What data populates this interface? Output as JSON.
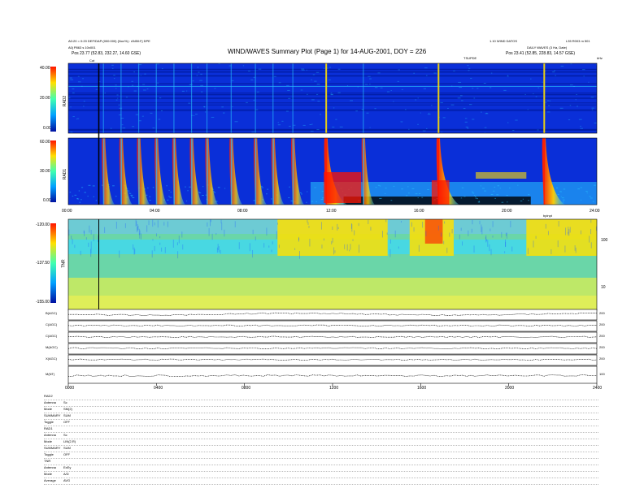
{
  "header": {
    "title": "WIND/WAVES Summary Plot (Page 1) for 14-AUG-2001, DOY = 226",
    "left_line1": "A0:20 = 0:20 DEF/DAP:(000:000) (Nov%) : AN50:Fj DPE",
    "left_line2": "A0j P863 s 10x001",
    "left_line3": "Pos   23.77 (52.83, 232.27, 14.60 GSE)",
    "right_line1": "1.10 WIND DATOS",
    "right_line2": "DAILY WAVES (3 Ha, Date)",
    "right_line3": "Pos   23.41 (52.85, 228.83, 14.57 GSE)",
    "right_corner": "L35 R003 m 501",
    "marker_label": "Cut",
    "rad1_mark": "TSUPDE",
    "tnr_mark": "bpinpt",
    "khz_mark": "kHz"
  },
  "panels": {
    "rad2": {
      "label": "RAD2",
      "ticks": [
        "40.00",
        "20.00",
        "0.00"
      ]
    },
    "rad1": {
      "label": "RAD1",
      "ticks": [
        "60.00",
        "30.00",
        "0.00"
      ]
    },
    "tnr": {
      "label": "TNR",
      "ticks": [
        "-120.00",
        "-137.50",
        "-155.00"
      ],
      "right_ticks": [
        "100",
        "10"
      ]
    }
  },
  "time_axis": {
    "ticks": [
      "00:00",
      "04:00",
      "08:00",
      "12:00",
      "16:00",
      "20:00",
      "24:00"
    ]
  },
  "bottom_axis": {
    "ticks": [
      "0000",
      "0400",
      "0800",
      "1200",
      "1600",
      "2000",
      "2400"
    ]
  },
  "line_panels": [
    {
      "label": "B(AGC)",
      "right": "200"
    },
    {
      "label": "C(AGC)",
      "right": "200"
    },
    {
      "label": "C(AGC)",
      "right": "200"
    },
    {
      "label": "M(AGC)",
      "right": "200"
    },
    {
      "label": "X(AGC)",
      "right": "200"
    },
    {
      "label": "M(NT)",
      "right": "100"
    }
  ],
  "info_block": [
    {
      "key": "RAD2",
      "val": ""
    },
    {
      "key": "Antenna",
      "val": "Sc"
    },
    {
      "key": "Mode",
      "val": "SM(2)"
    },
    {
      "key": "SUMMARY",
      "val": "SUM"
    },
    {
      "key": "Toggle",
      "val": "OFF"
    },
    {
      "key": "RAD1",
      "val": ""
    },
    {
      "key": "Antenna",
      "val": "Sc"
    },
    {
      "key": "Mode",
      "val": "LIN(2,R)"
    },
    {
      "key": "SUMMARY",
      "val": "SUM"
    },
    {
      "key": "Toggle",
      "val": "OFF"
    },
    {
      "key": "TNR",
      "val": ""
    },
    {
      "key": "Antenna",
      "val": "ExEy"
    },
    {
      "key": "Mode",
      "val": "A/D"
    },
    {
      "key": "Average",
      "val": "AVG"
    }
  ],
  "colors": {
    "background": "#0a2fd8",
    "deep": "#001a9e",
    "cyan": "#28c8ff",
    "yellow": "#ffe000",
    "red": "#ff1400",
    "tnr_base": "#6ad6a8"
  },
  "chart_data": {
    "type": "heatmap",
    "title": "WIND/WAVES Summary Plot (Page 1) for 14-AUG-2001, DOY = 226",
    "x_unit": "hours UT",
    "x_range": [
      0,
      24
    ],
    "rad2_ylim": [
      0,
      40
    ],
    "rad1_ylim": [
      0,
      60
    ],
    "tnr_colorbar_range": [
      -155,
      -120
    ],
    "type_iii_bursts_hours": [
      1.6,
      2.4,
      3.2,
      4.0,
      4.8,
      5.6,
      6.3,
      7.4,
      8.5,
      9.3,
      10.2,
      11.7,
      13.4,
      16.8,
      21.6
    ],
    "strong_bursts_hours": [
      11.7,
      16.8,
      21.6
    ],
    "marker_hours": [
      1.2
    ]
  }
}
